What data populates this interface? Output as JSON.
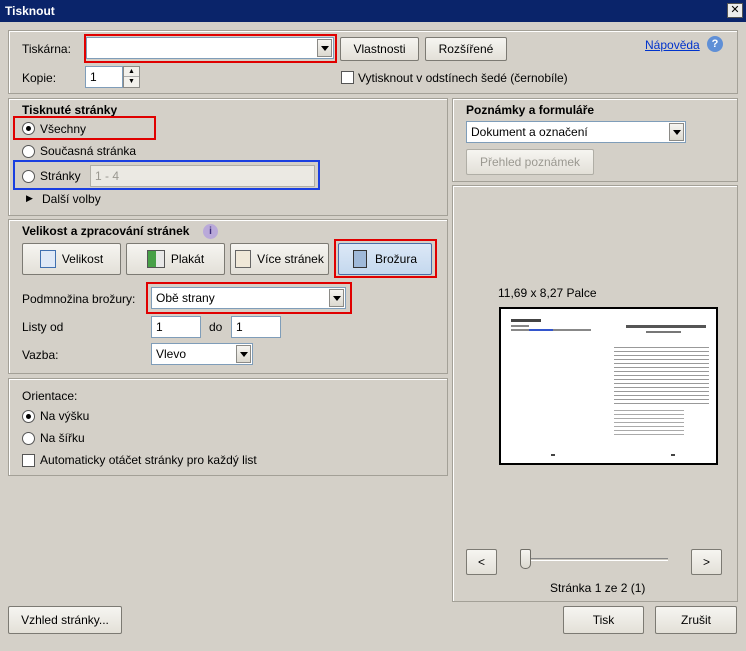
{
  "window": {
    "title": "Tisknout",
    "close_glyph": "✕"
  },
  "printer": {
    "label": "Tiskárna:",
    "value": "",
    "properties_button": "Vlastnosti",
    "advanced_button": "Rozšířené",
    "help_link": "Nápověda",
    "copies_label": "Kopie:",
    "copies_value": "1",
    "grayscale_label": "Vytisknout v odstínech šedé (černobíle)"
  },
  "pages": {
    "header": "Tisknuté stránky",
    "all": "Všechny",
    "current": "Současná stránka",
    "range": "Stránky",
    "range_value": "1 - 4",
    "more": "Další volby"
  },
  "sizing": {
    "header": "Velikost a zpracování stránek",
    "buttons": [
      "Velikost",
      "Plakát",
      "Více stránek",
      "Brožura"
    ],
    "subset_label": "Podmnožina brožury:",
    "subset_value": "Obě strany",
    "sheets_label": "Listy od",
    "sheets_from": "1",
    "sheets_to_label": "do",
    "sheets_to": "1",
    "binding_label": "Vazba:",
    "binding_value": "Vlevo"
  },
  "orientation": {
    "header": "Orientace:",
    "portrait": "Na výšku",
    "landscape": "Na šířku",
    "auto_rotate": "Automaticky otáčet stránky pro každý list"
  },
  "comments": {
    "header": "Poznámky a formuláře",
    "value": "Dokument a označení",
    "summarize": "Přehled poznámek"
  },
  "preview": {
    "size": "11,69 x 8,27 Palce",
    "prev": "<",
    "next": ">",
    "page_info": "Stránka 1 ze 2 (1)"
  },
  "footer": {
    "page_setup": "Vzhled stránky...",
    "print": "Tisk",
    "cancel": "Zrušit"
  },
  "colors": {
    "annotation_red": "#e00000",
    "annotation_blue": "#1a3fe0",
    "title_bar": "#0a246a"
  }
}
